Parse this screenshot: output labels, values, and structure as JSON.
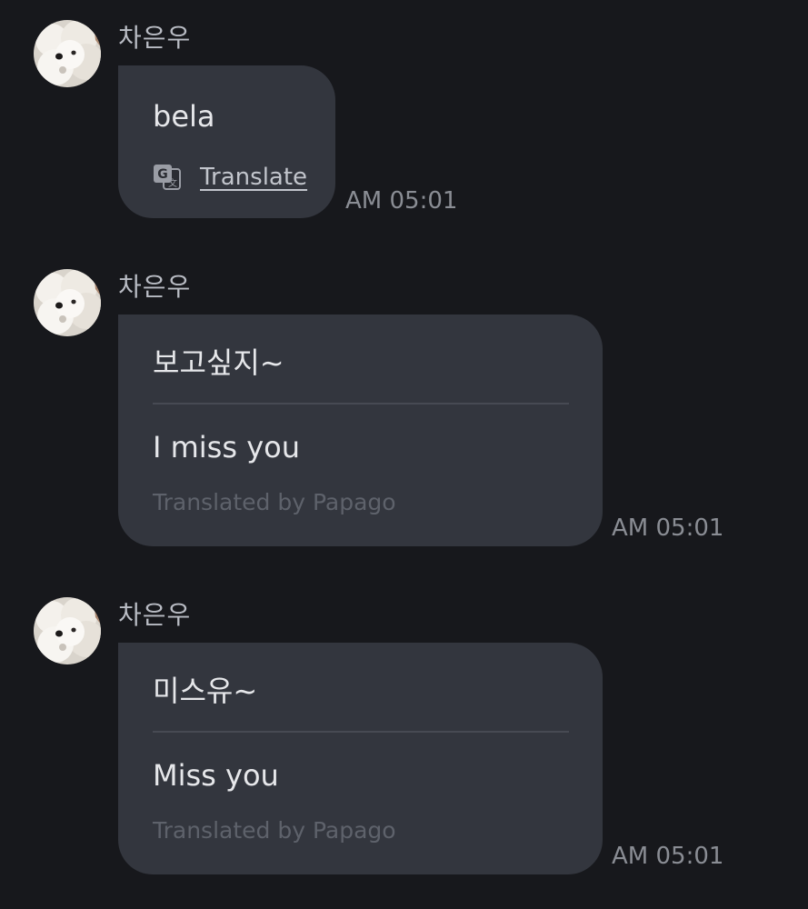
{
  "colors": {
    "background": "#17181c",
    "bubble": "#33363e",
    "text": "#e6e7ea",
    "sender": "#b9bcc4",
    "timestamp": "#8a8d94",
    "translated_by": "#5e626b"
  },
  "messages": [
    {
      "sender": "차은우",
      "avatar_icon": "dog-avatar-icon",
      "text": "bela",
      "translate_icon": "translate-icon",
      "translate_label": "Translate",
      "time": "AM 05:01"
    },
    {
      "sender": "차은우",
      "avatar_icon": "dog-avatar-icon",
      "original": "보고싶지~",
      "translation": "I miss you",
      "translated_by": "Translated by Papago",
      "time": "AM 05:01"
    },
    {
      "sender": "차은우",
      "avatar_icon": "dog-avatar-icon",
      "original": "미스유~",
      "translation": "Miss you",
      "translated_by": "Translated by Papago",
      "time": "AM 05:01"
    }
  ]
}
